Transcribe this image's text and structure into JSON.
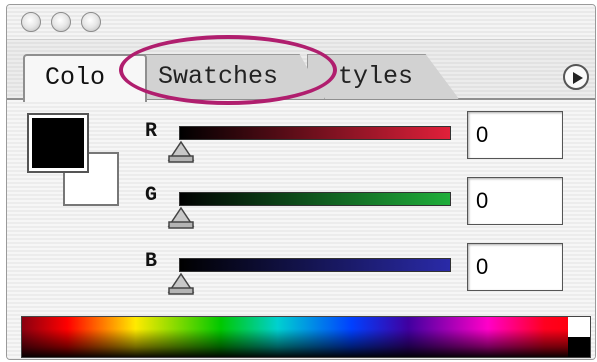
{
  "window": {
    "traffic_lights": [
      "close",
      "minimize",
      "zoom"
    ]
  },
  "tabs": [
    {
      "label": "Color",
      "visible_text": "Colo",
      "active": true
    },
    {
      "label": "Swatches",
      "active": false,
      "highlighted": true
    },
    {
      "label": "Styles",
      "visible_text": "tyles",
      "active": false
    }
  ],
  "panel_menu_icon": "play-arrow-icon",
  "swatches": {
    "foreground": "#000000",
    "background": "#ffffff"
  },
  "channels": [
    {
      "label": "R",
      "value": "0",
      "gradient_to": "#e0203a"
    },
    {
      "label": "G",
      "value": "0",
      "gradient_to": "#1fae3a"
    },
    {
      "label": "B",
      "value": "0",
      "gradient_to": "#2a2aa8"
    }
  ],
  "highlight_color": "#b01e6e",
  "spectrum_bar": "color-ramp"
}
